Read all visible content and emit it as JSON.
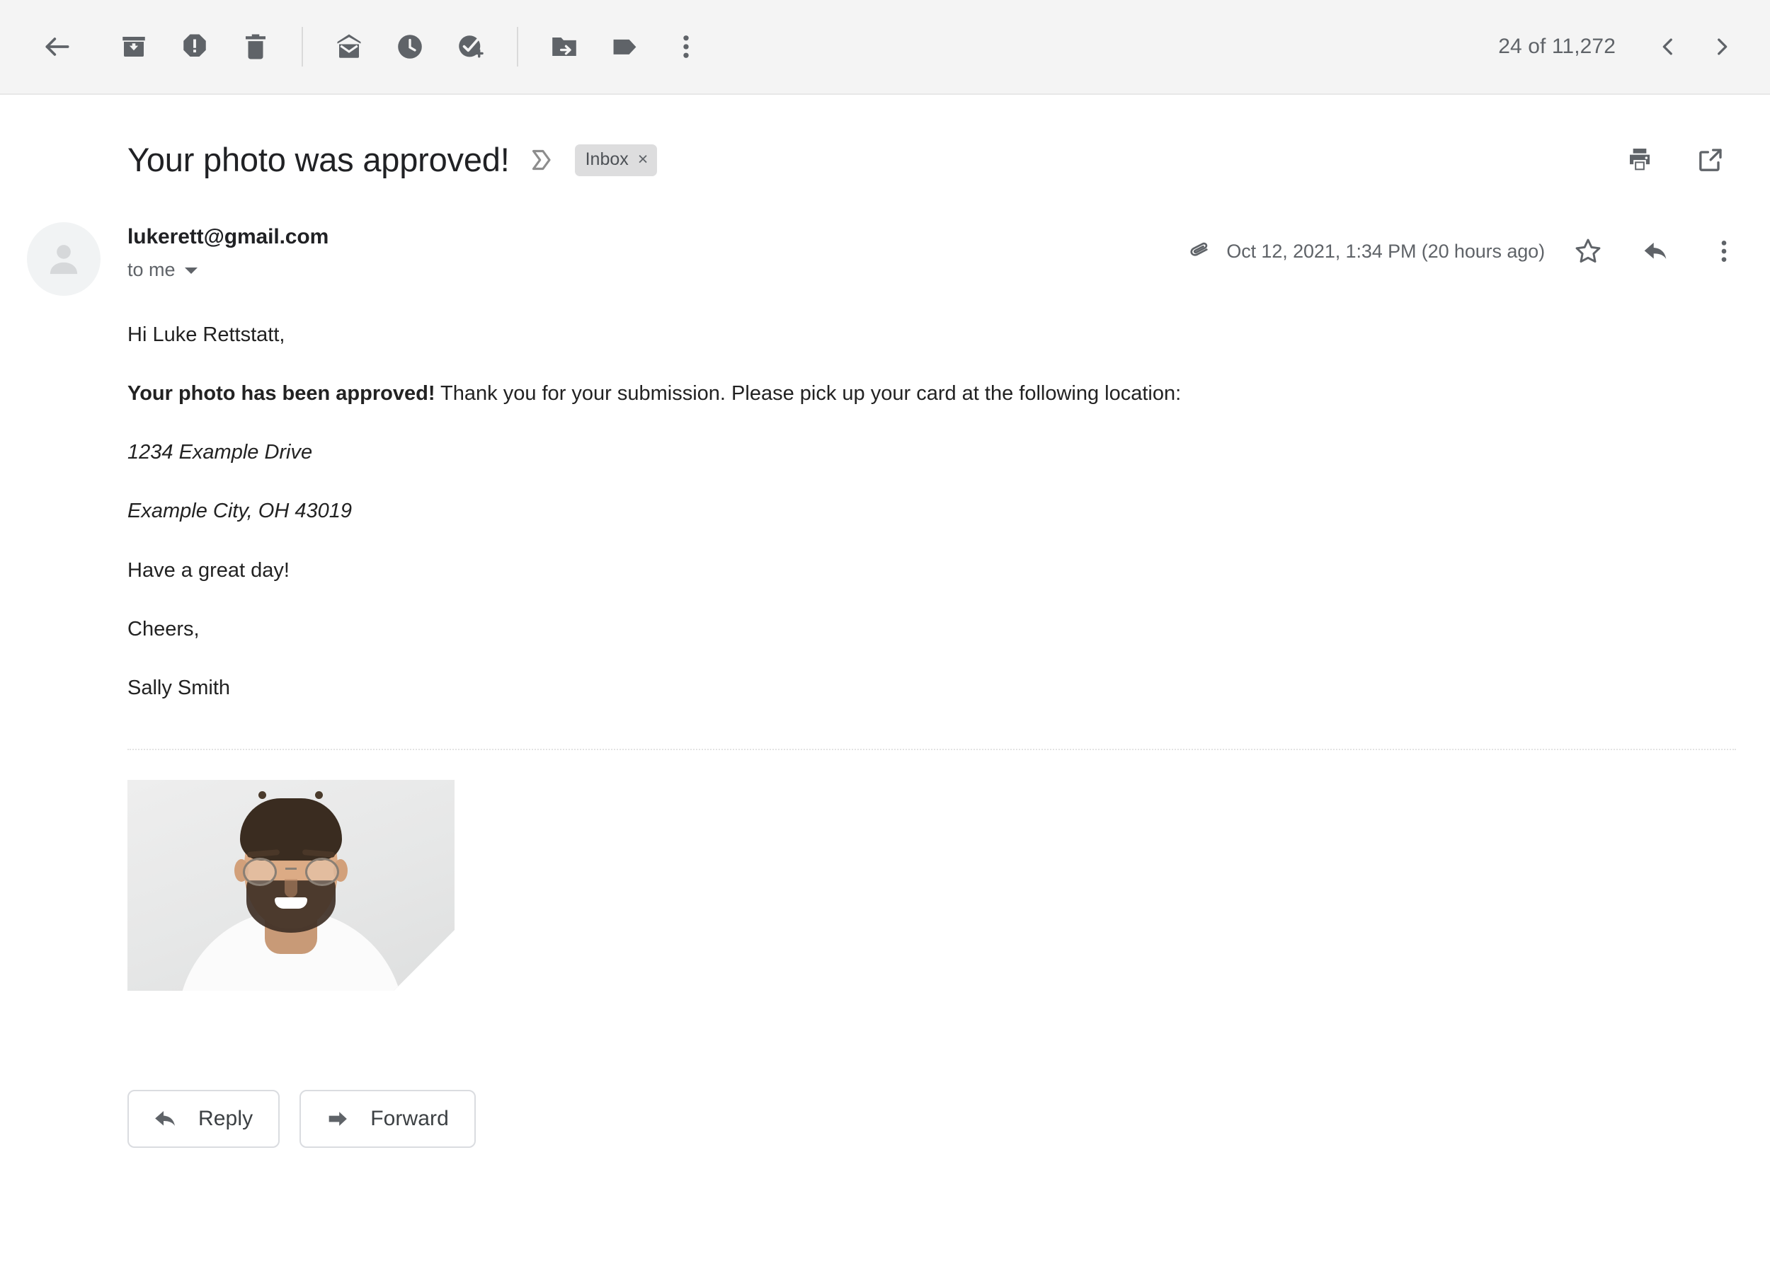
{
  "toolbar": {
    "back_label": "Back",
    "actions": [
      {
        "name": "archive-icon",
        "label": "Archive"
      },
      {
        "name": "report-spam-icon",
        "label": "Report spam"
      },
      {
        "name": "delete-icon",
        "label": "Delete"
      },
      {
        "name": "mark-unread-icon",
        "label": "Mark as unread"
      },
      {
        "name": "snooze-icon",
        "label": "Snooze"
      },
      {
        "name": "add-to-tasks-icon",
        "label": "Add to tasks"
      },
      {
        "name": "move-to-icon",
        "label": "Move to"
      },
      {
        "name": "labels-icon",
        "label": "Labels"
      },
      {
        "name": "more-icon",
        "label": "More"
      }
    ],
    "counter": "24 of 11,272",
    "prev_label": "Newer",
    "next_label": "Older"
  },
  "subject": {
    "title": "Your photo was approved!",
    "important_marker": "important-marker-icon",
    "label": "Inbox",
    "label_remove": "×",
    "print_label": "Print all",
    "open_new_window_label": "Open in new window"
  },
  "sender": {
    "avatar": "default-avatar-icon",
    "email": "lukerett@gmail.com",
    "recipient": "to me",
    "attachment_indicator": "attachment-icon",
    "date": "Oct 12, 2021, 1:34 PM (20 hours ago)",
    "star_label": "Not starred",
    "reply_label": "Reply",
    "more_label": "More"
  },
  "message": {
    "greeting": "Hi Luke Rettstatt,",
    "approval_bold": "Your photo has been approved!",
    "approval_rest": " Thank you for your submission. Please pick up your card at the following location:",
    "address_line1": "1234 Example Drive",
    "address_line2": "Example City, OH 43019",
    "closing_line": "Have a great day!",
    "signoff": "Cheers,",
    "signature": "Sally Smith"
  },
  "attachment": {
    "alt": "Portrait photo of a smiling man with glasses and a beard wearing a white t-shirt"
  },
  "footer": {
    "reply_label": "Reply",
    "forward_label": "Forward"
  },
  "colors": {
    "toolbar_background": "#f4f4f4",
    "icon_gray": "#5f6368",
    "text_primary": "#202124",
    "text_secondary": "#5f6368",
    "chip_background": "#ddddde",
    "button_border": "#dadce0"
  }
}
